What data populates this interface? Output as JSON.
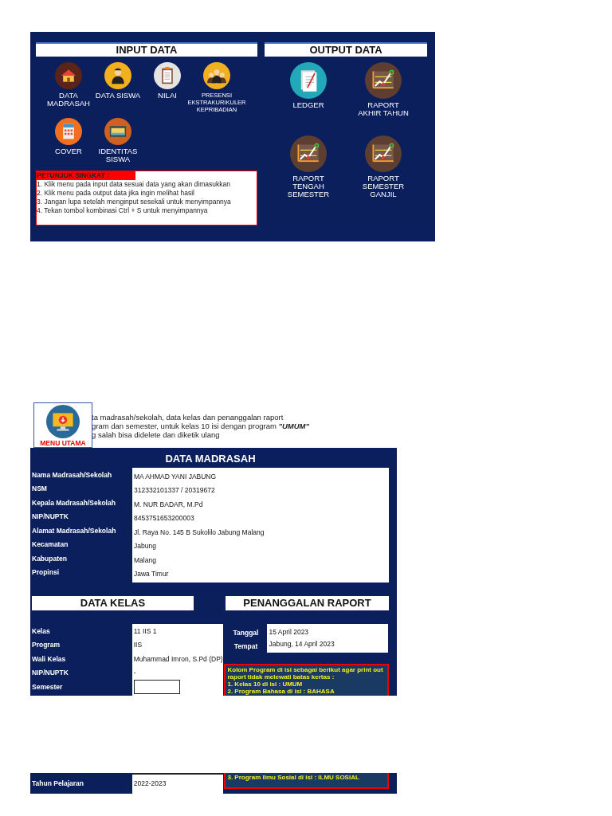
{
  "input_panel": {
    "title": "INPUT DATA",
    "menu": [
      {
        "label": "DATA MADRASAH"
      },
      {
        "label": "DATA SISWA"
      },
      {
        "label": "NILAI"
      },
      {
        "label": "PRESENSI EKSTRAKURIKULER KEPRIBADIAN",
        "small": true
      },
      {
        "label": "COVER"
      },
      {
        "label": "IDENTITAS SISWA"
      }
    ],
    "tips": {
      "title": "PETUNJUK SINGKAT :",
      "lines": [
        "1. Klik menu pada input data sesuai data yang akan dimasukkan",
        "2. Klik menu pada output data jika ingin melihat hasil",
        "3. Jangan lupa setelah menginput sesekali untuk menyimpannya",
        "4. Tekan tombol kombinasi Ctrl + S untuk menyimpannya"
      ]
    }
  },
  "output_panel": {
    "title": "OUTPUT DATA",
    "menu": [
      {
        "label": "LEDGER"
      },
      {
        "label": "RAPORT AKHIR TAHUN"
      },
      {
        "label": "RAPORT TENGAH SEMESTER"
      },
      {
        "label": "RAPORT SEMESTER GANJIL"
      }
    ]
  },
  "menu_button": {
    "label": "MENU UTAMA"
  },
  "intro_lines": [
    "ta madrasah/sekolah, data kelas dan penanggalan raport",
    "gram dan semester, untuk kelas 10 isi dengan program **\"UMUM\"**",
    "g salah bisa didelete dan diketik ulang"
  ],
  "data_madrasah": {
    "title": "DATA MADRASAH",
    "rows": [
      {
        "label": "Nama Madrasah/Sekolah",
        "value": "MA AHMAD YANI JABUNG"
      },
      {
        "label": "NSM",
        "value": "312332101337 / 20319672"
      },
      {
        "label": "Kepala Madrasah/Sekolah",
        "value": "M. NUR BADAR, M.Pd"
      },
      {
        "label": "NIP/NUPTK",
        "value": "8453751653200003"
      },
      {
        "label": "Alamat Madrasah/Sekolah",
        "value": "Jl. Raya No.  145 B Sukolilo Jabung Malang"
      },
      {
        "label": "Kecamatan",
        "value": "Jabung"
      },
      {
        "label": "Kabupaten",
        "value": "Malang"
      },
      {
        "label": "Propinsi",
        "value": "Jawa Timur"
      }
    ]
  },
  "data_kelas": {
    "title": "DATA KELAS",
    "rows": [
      {
        "label": "Kelas",
        "value": "11 IIS 1"
      },
      {
        "label": "Program",
        "value": "IIS"
      },
      {
        "label": "Wali Kelas",
        "value": "Muhammad Imron, S.Pd (DP)"
      },
      {
        "label": "NIP/NUPTK",
        "value": "-"
      },
      {
        "label": "Semester"
      }
    ],
    "continued_rows": [
      {
        "label": "Tahun Pelajaran",
        "value": "2022-2023"
      }
    ]
  },
  "penanggalan_raport": {
    "title": "PENANGGALAN RAPORT",
    "rows": [
      {
        "label": "Tanggal",
        "value": "15 April 2023"
      },
      {
        "label": "Tempat",
        "value": "Jabung, 14 April 2023"
      }
    ],
    "note_lines": [
      "Kolom Program di isi sebagai berikut agar print out raport tidak melewati batas kertas :",
      "1. Kelas 10 di isi : UMUM",
      "2. Program Bahasa di isi : BAHASA"
    ],
    "note_continued_lines": [
      "3. Program Ilmu Sosial di isi : ILMU SOSIAL"
    ]
  }
}
